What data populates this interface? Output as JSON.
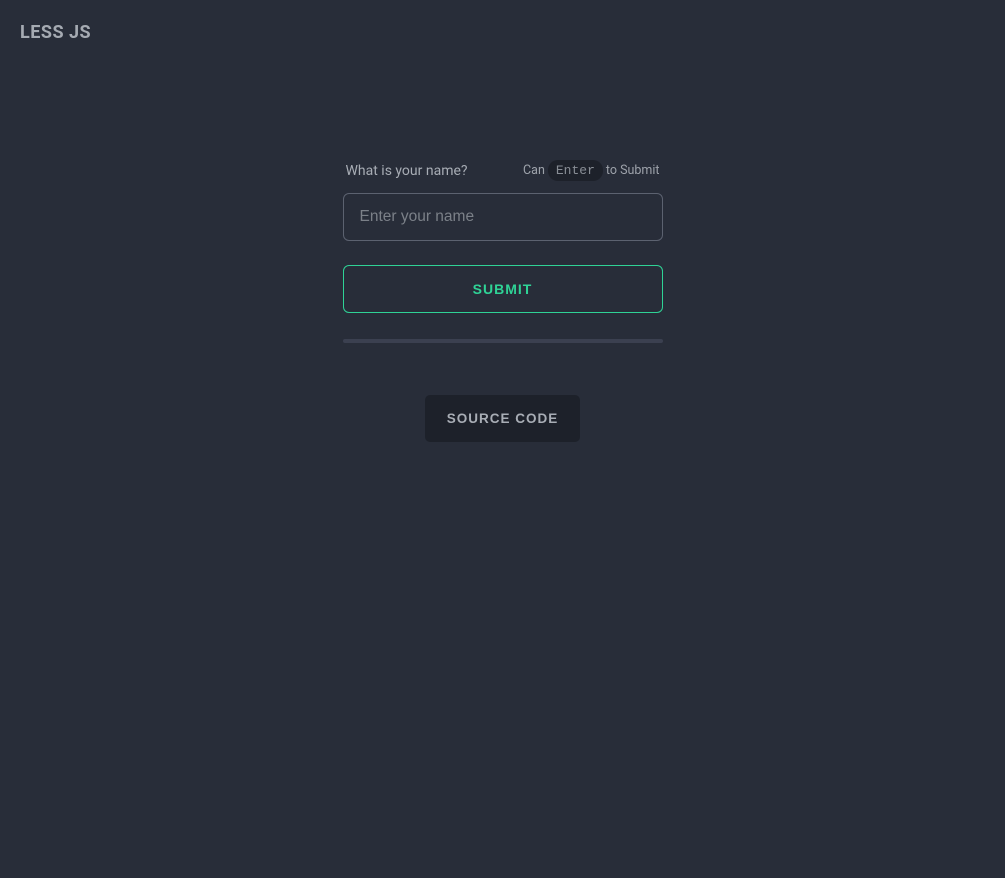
{
  "header": {
    "title": "LESS JS"
  },
  "form": {
    "question_label": "What is your name?",
    "hint_prefix": "Can",
    "hint_key": "Enter",
    "hint_suffix": "to Submit",
    "input_placeholder": "Enter your name",
    "submit_label": "SUBMIT"
  },
  "footer": {
    "source_code_label": "SOURCE CODE"
  }
}
